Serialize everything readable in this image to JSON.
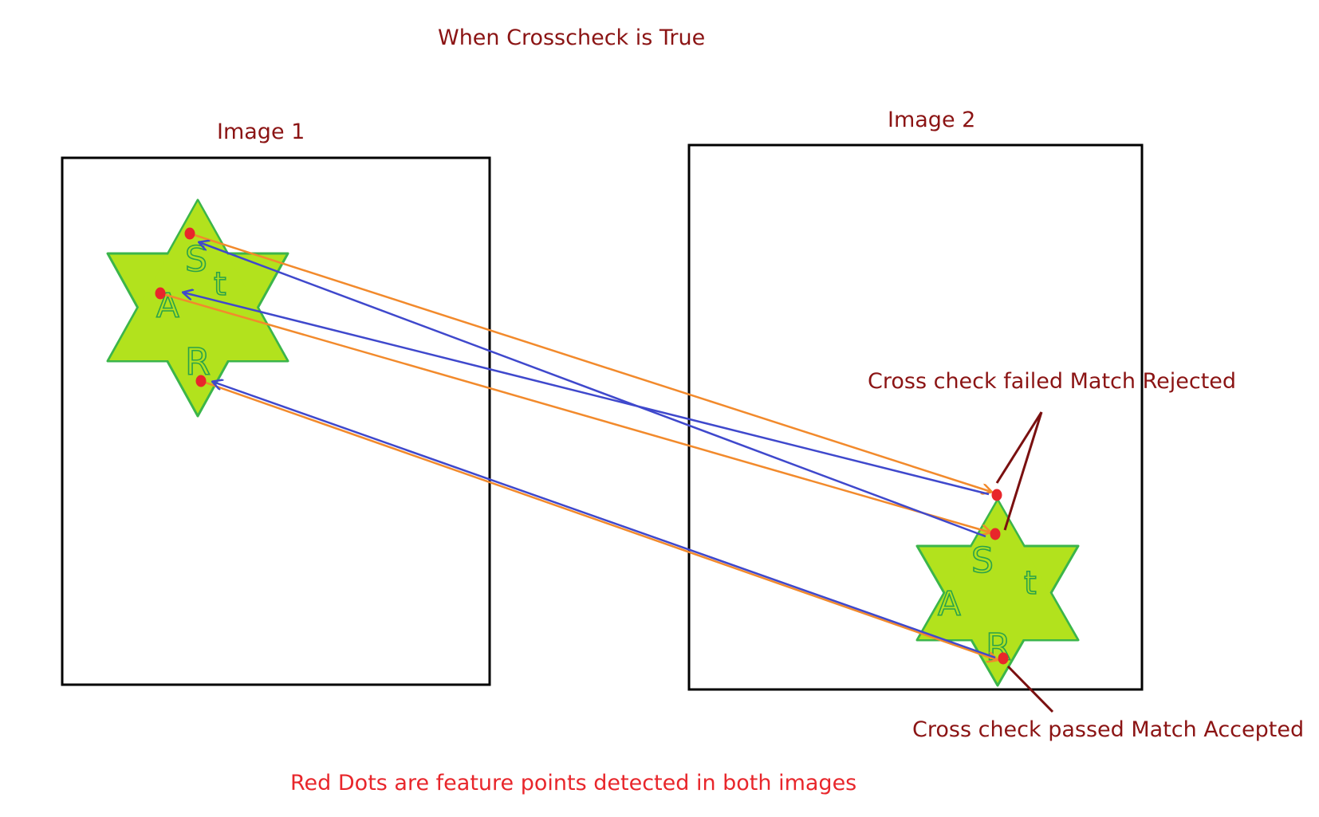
{
  "title": "When Crosscheck is True",
  "image1_label": "Image 1",
  "image2_label": "Image 2",
  "annotation_rejected": "Cross check failed Match Rejected",
  "annotation_accepted": "Cross check passed Match Accepted",
  "footnote": "Red Dots are feature points detected in both images",
  "star_letters": [
    "S",
    "t",
    "A",
    "R"
  ],
  "colors": {
    "title_text": "#8b1414",
    "footnote_text": "#e8262b",
    "star_fill": "#b2e21d",
    "star_stroke": "#3bb54a",
    "feature_dot": "#e8262b",
    "forward_match": "#f28a2c",
    "backward_match": "#3f48cc",
    "annotation_line": "#7a1010",
    "frame": "#000000"
  }
}
